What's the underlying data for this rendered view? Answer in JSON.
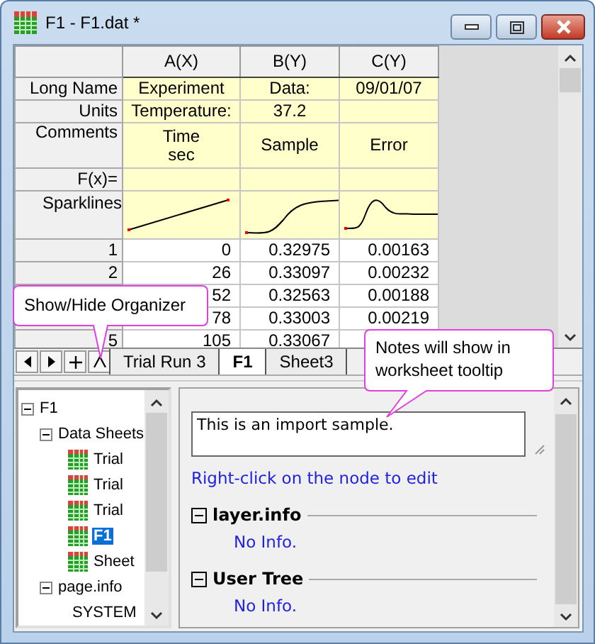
{
  "window": {
    "title": "F1 - F1.dat *"
  },
  "worksheet": {
    "columns": [
      "A(X)",
      "B(Y)",
      "C(Y)"
    ],
    "label_rows": [
      {
        "label": "Long Name",
        "cells": [
          "Experiment",
          "Data:",
          "09/01/07"
        ]
      },
      {
        "label": "Units",
        "cells": [
          "Temperature:",
          "37.2",
          null
        ]
      },
      {
        "label": "Comments",
        "cells": [
          "Time\nsec",
          "Sample",
          "Error"
        ]
      },
      {
        "label": "F(x)=",
        "cells": [
          null,
          null,
          null
        ]
      }
    ],
    "sparklines_label": "Sparklines",
    "rows": [
      {
        "label": "1",
        "cells": [
          "0",
          "0.32975",
          "0.00163"
        ]
      },
      {
        "label": "2",
        "cells": [
          "26",
          "0.33097",
          "0.00232"
        ]
      },
      {
        "cells": [
          "52",
          "0.32563",
          "0.00188"
        ]
      },
      {
        "cells": [
          "78",
          "0.33003",
          "0.00219"
        ]
      },
      {
        "label": "5",
        "cells": [
          "105",
          "0.33067",
          null
        ]
      }
    ]
  },
  "tabs": [
    {
      "label": "Trial Run 3",
      "selected": false
    },
    {
      "label": "F1",
      "selected": true
    },
    {
      "label": "Sheet3",
      "selected": false
    }
  ],
  "tree": [
    {
      "label": "F1",
      "kind": "folder",
      "expanded": true,
      "selected": false,
      "children": [
        {
          "label": "Data Sheets",
          "kind": "folder",
          "expanded": true,
          "selected": false,
          "children": [
            {
              "label": "Trial",
              "kind": "sheet",
              "selected": false
            },
            {
              "label": "Trial",
              "kind": "sheet",
              "selected": false
            },
            {
              "label": "Trial",
              "kind": "sheet",
              "selected": false
            },
            {
              "label": "F1",
              "kind": "sheet",
              "selected": true
            },
            {
              "label": "Sheet",
              "kind": "sheet",
              "selected": false
            }
          ]
        },
        {
          "label": "page.info",
          "kind": "folder",
          "expanded": true,
          "selected": false,
          "children": [
            {
              "label": "SYSTEM",
              "kind": "info",
              "selected": false
            }
          ]
        }
      ]
    }
  ],
  "notes": {
    "value": "This is an import sample."
  },
  "hint": "Right-click on the node to edit",
  "sections": [
    {
      "title": "layer.info",
      "expanded": true,
      "body": "No Info."
    },
    {
      "title": "User Tree",
      "expanded": true,
      "body": "No Info."
    }
  ],
  "tooltips": [
    {
      "text": "Show/Hide Organizer"
    },
    {
      "text": "Notes will show in worksheet tooltip"
    }
  ]
}
